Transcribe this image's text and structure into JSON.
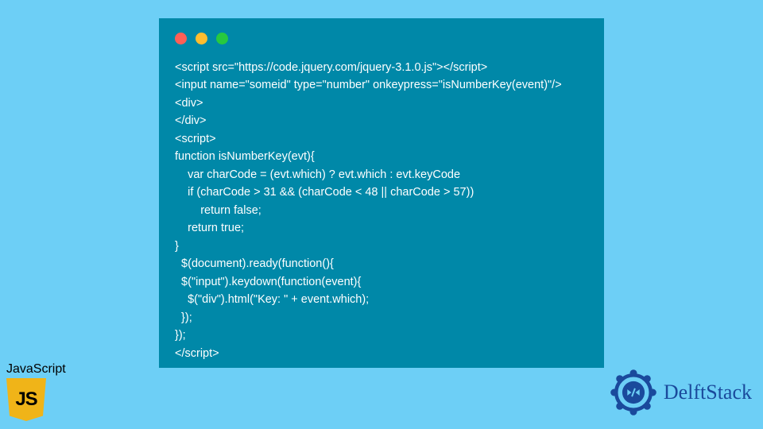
{
  "code_lines": [
    "<script src=\"https://code.jquery.com/jquery-3.1.0.js\"></script>",
    "<input name=\"someid\" type=\"number\" onkeypress=\"isNumberKey(event)\"/>",
    "<div>",
    "</div>",
    "<script>",
    "function isNumberKey(evt){",
    "    var charCode = (evt.which) ? evt.which : evt.keyCode",
    "    if (charCode > 31 && (charCode < 48 || charCode > 57))",
    "        return false;",
    "    return true;",
    "}",
    "  $(document).ready(function(){",
    "  $(\"input\").keydown(function(event){",
    "    $(\"div\").html(\"Key: \" + event.which);",
    "  });",
    "});",
    "</script>"
  ],
  "js_badge": {
    "label": "JavaScript",
    "shield_text": "JS"
  },
  "brand": {
    "name": "DelftStack"
  },
  "colors": {
    "page_bg": "#6dcff6",
    "window_bg": "#0088a8",
    "code_text": "#ffffff",
    "dot_red": "#ff5f56",
    "dot_yellow": "#ffbd2e",
    "dot_green": "#27c93f",
    "js_yellow": "#f0b418",
    "brand_blue": "#1a4a9c"
  }
}
